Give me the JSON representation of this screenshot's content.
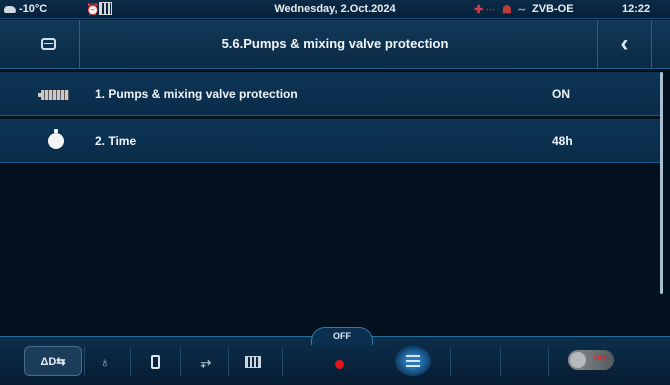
{
  "status_bar": {
    "outdoor_temp": "-10°C",
    "date": "Wednesday, 2.Oct.2024",
    "device": "ZVB-OE",
    "time": "12:22"
  },
  "header": {
    "title": "5.6.Pumps & mixing valve protection"
  },
  "settings": [
    {
      "label": "1.  Pumps & mixing valve protection",
      "value": "ON",
      "icon": "pump-icon"
    },
    {
      "label": "2.  Time",
      "value": "48h",
      "icon": "timer-icon"
    }
  ],
  "bottom_bar": {
    "mode_label": "ΔD⇆",
    "off_label": "OFF",
    "toggle_label": "OFF"
  },
  "colors": {
    "background": "#04111f",
    "header": "#123957",
    "row": "#0d3455",
    "accent_red": "#e3141c"
  }
}
